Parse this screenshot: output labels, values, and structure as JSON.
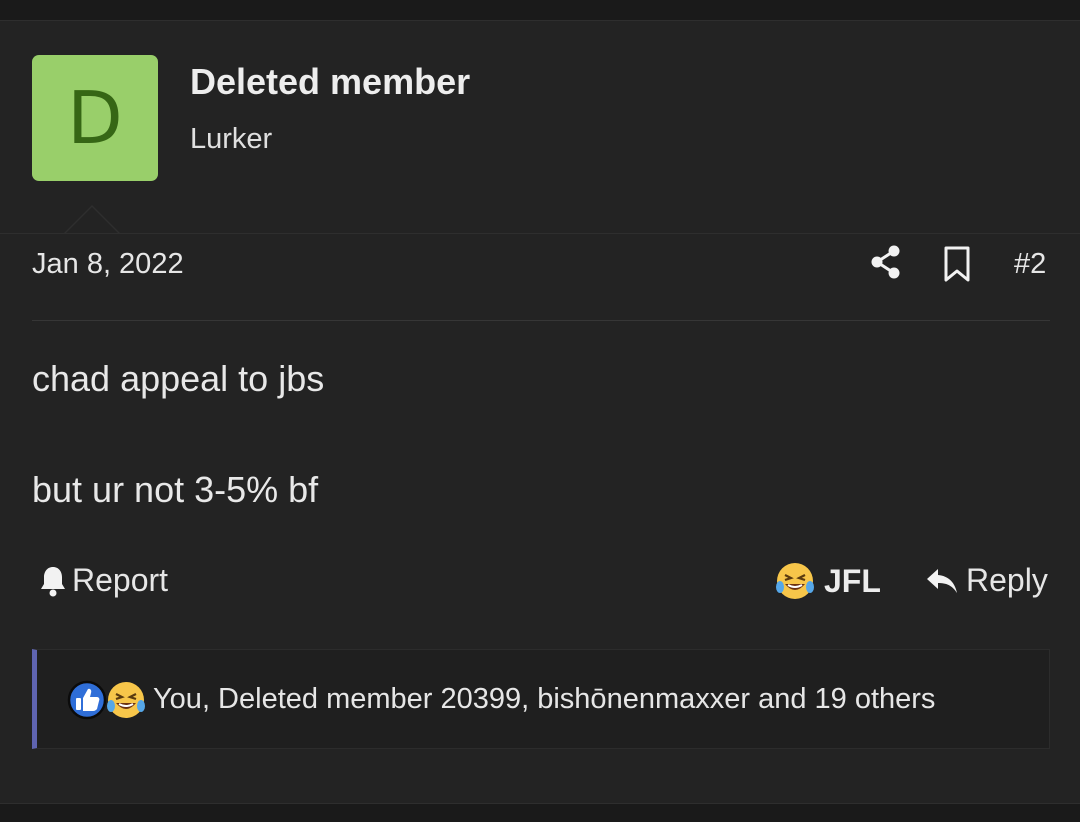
{
  "post": {
    "author": {
      "avatar_letter": "D",
      "avatar_color": "#99cf6a",
      "name": "Deleted member",
      "title": "Lurker"
    },
    "date": "Jan 8, 2022",
    "number": "#2",
    "body": {
      "line1": "chad appeal to jbs",
      "line2": "but ur not 3-5% bf"
    },
    "actions": {
      "report_label": "Report",
      "reaction_label": "JFL",
      "reply_label": "Reply"
    },
    "reactions_summary": {
      "text": "You, Deleted member 20399, bishōnenmaxxer and 19 others",
      "icons": [
        "like-icon",
        "laughing-crying-emoji-icon"
      ],
      "accent_color": "#5f64b0"
    }
  }
}
